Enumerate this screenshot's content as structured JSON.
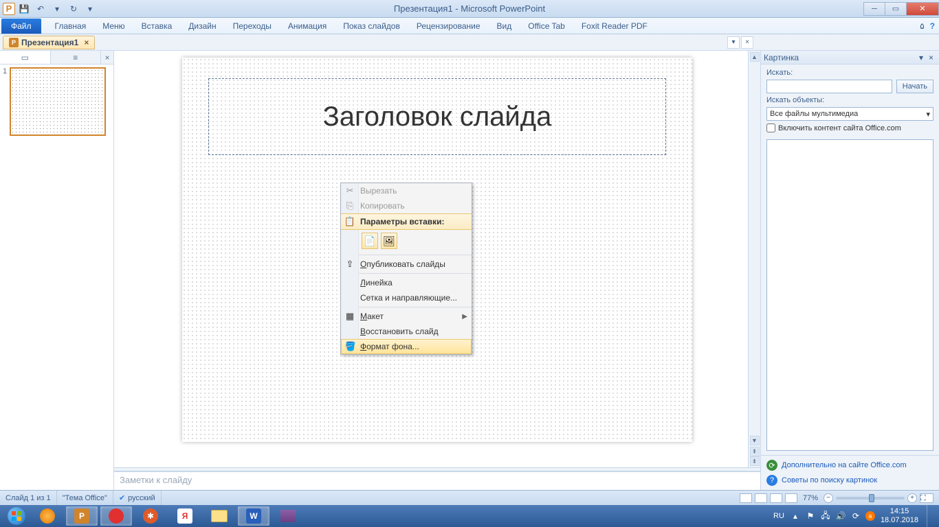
{
  "title": "Презентация1 - Microsoft PowerPoint",
  "qat": {
    "save": "💾",
    "undo": "↶",
    "redo": "↻"
  },
  "ribbon": {
    "file": "Файл",
    "tabs": [
      "Главная",
      "Меню",
      "Вставка",
      "Дизайн",
      "Переходы",
      "Анимация",
      "Показ слайдов",
      "Рецензирование",
      "Вид",
      "Office Tab",
      "Foxit Reader PDF"
    ]
  },
  "doc_tab": {
    "name": "Презентация1",
    "close": "×"
  },
  "thumb": {
    "num": "1"
  },
  "slide": {
    "title_placeholder": "Заголовок слайда"
  },
  "context_menu": {
    "cut": "Вырезать",
    "copy": "Копировать",
    "paste_opts": "Параметры вставки:",
    "publish": "Опубликовать слайды",
    "ruler": "Линейка",
    "grid": "Сетка и направляющие...",
    "layout": "Макет",
    "reset": "Восстановить слайд",
    "format_bg": "Формат фона..."
  },
  "taskpane": {
    "title": "Картинка",
    "search_label": "Искать:",
    "search_button": "Начать",
    "objects_label": "Искать объекты:",
    "objects_value": "Все файлы мультимедиа",
    "include_office": "Включить контент сайта Office.com",
    "link1": "Дополнительно на сайте Office.com",
    "link2": "Советы по поиску картинок"
  },
  "notes": "Заметки к слайду",
  "statusbar": {
    "slide": "Слайд 1 из 1",
    "theme": "\"Тема Office\"",
    "lang": "русский",
    "zoom": "77%"
  },
  "taskbar": {
    "lang": "RU",
    "time": "14:15",
    "date": "18.07.2018"
  }
}
